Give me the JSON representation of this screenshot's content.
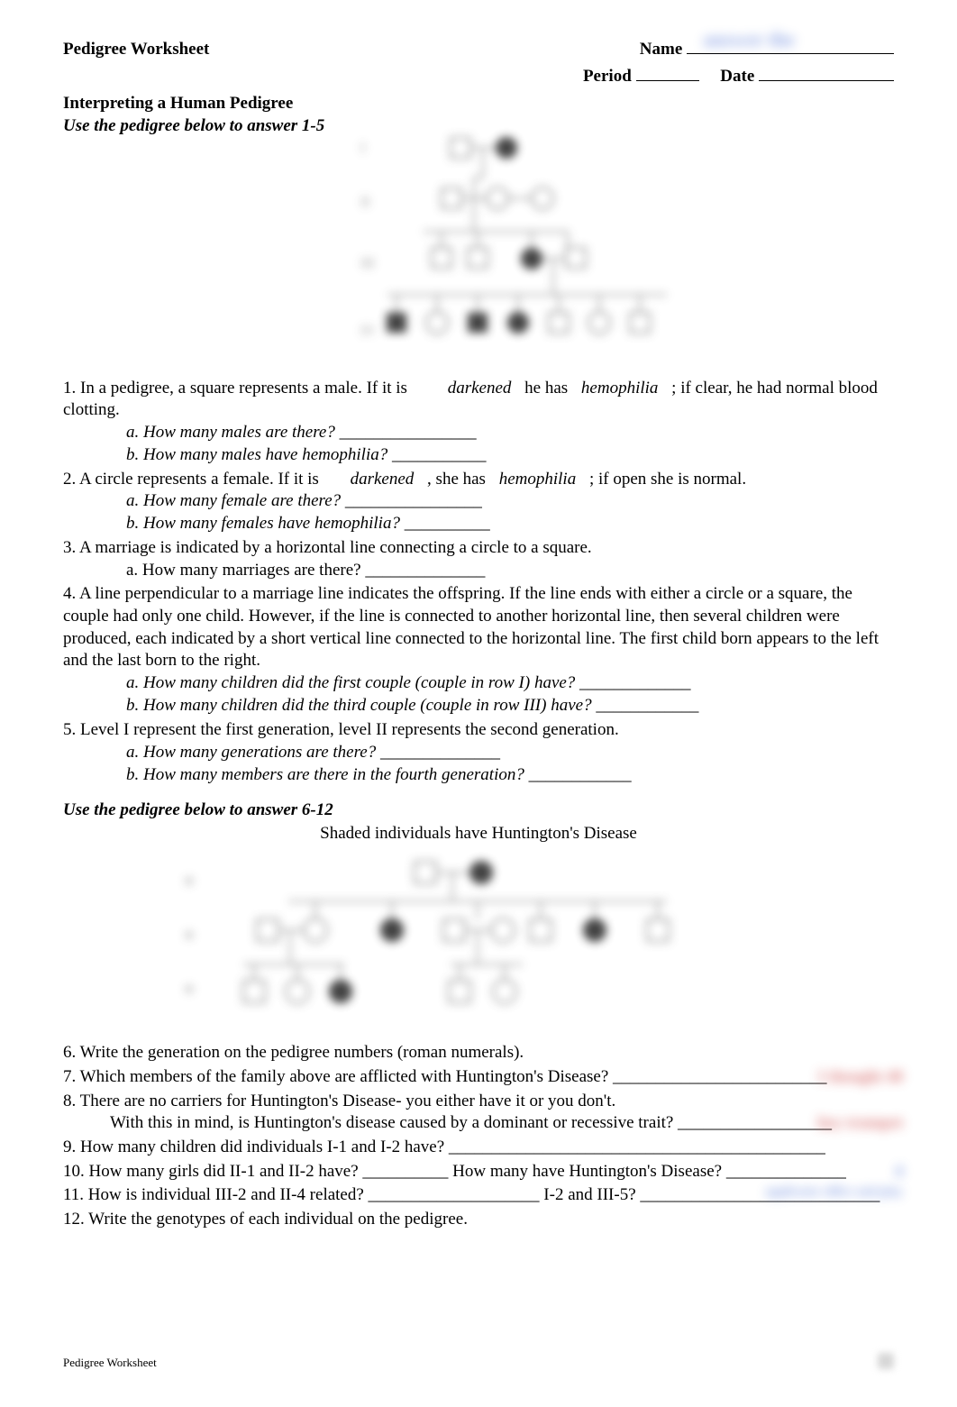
{
  "header": {
    "title": "Pedigree Worksheet",
    "name_label": "Name",
    "period_label": "Period",
    "date_label": "Date",
    "name_answer": "answer the"
  },
  "subtitle": "Interpreting a Human Pedigree",
  "instruction1": "Use the pedigree below to answer 1-5",
  "q1": {
    "prefix": "1. In a pedigree, a square represents a male. If it is",
    "kw1": "darkened",
    "mid1": "he has",
    "kw2": "hemophilia",
    "suffix": "; if clear, he had normal blood clotting.",
    "a": "a. How many males are there? ________________",
    "b": "b. How many males have hemophilia? ___________"
  },
  "q2": {
    "prefix": "2. A circle represents a female. If it is",
    "kw1": "darkened",
    "mid": ", she has",
    "kw2": "hemophilia",
    "suffix": "; if open she is normal.",
    "a": "a. How many female are there? ________________",
    "b": "b. How many females have hemophilia? __________"
  },
  "q3": {
    "text": "3. A marriage is indicated by a horizontal line connecting a circle to a square.",
    "a": "a. How many marriages are there? ______________"
  },
  "q4": {
    "text": "4. A line perpendicular to a marriage line indicates the offspring. If the line ends with either a circle or a square, the couple had only one child. However, if the line is connected to another horizontal line, then several children were produced, each indicated by a short vertical line connected to the horizontal line. The first child born appears to the left and the last born to the right.",
    "a": "a. How many children did the first couple (couple in row I) have? _____________",
    "b": "b. How many children did the third couple (couple in row III) have? ____________"
  },
  "q5": {
    "text": "5. Level I represent the first generation, level II represents the second generation.",
    "a": "a. How many generations are there? ______________",
    "b": "b. How many members are there in the fourth generation? ____________"
  },
  "instruction2": "Use the pedigree below to answer 6-12",
  "shaded_caption": "Shaded individuals have Huntington's Disease",
  "q6": "6. Write the generation on the pedigree numbers (roman numerals).",
  "q7": "7. Which members of the family above are afflicted with Huntington's Disease? _________________________",
  "q8": {
    "line1": "8. There are no carriers for Huntington's Disease- you either have it or you don't.",
    "line2": "With this in mind, is Huntington's disease caused by a dominant or recessive trait? __________________"
  },
  "q9": "9. How many children did individuals I-1 and I-2 have? ____________________________________________",
  "q10": "10. How many girls did II-1 and II-2 have? __________ How many have Huntington's Disease? ______________",
  "q11": "11. How is individual III-2 and II-4 related? ____________________ I-2 and III-5? ____________________________",
  "q12": "12. Write the genotypes of each individual on the pedigree.",
  "footer": "Pedigree Worksheet",
  "blur_side": {
    "a": "I thought 40",
    "b": "hey trumpet",
    "c": "4",
    "d": "applicator office and play"
  }
}
